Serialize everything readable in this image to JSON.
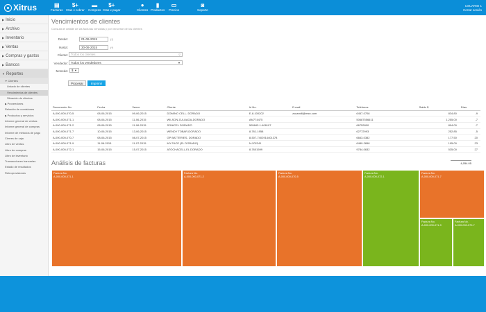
{
  "app": {
    "logo": "Xitrus"
  },
  "toolbar": [
    {
      "label": "Facturas",
      "icon": "invoice-icon",
      "glyph": "▤"
    },
    {
      "label": "Ctas x cobrar",
      "icon": "receivable-icon",
      "glyph": "$+"
    },
    {
      "label": "Compras",
      "icon": "folder-icon",
      "glyph": "▬"
    },
    {
      "label": "Ctas x pagar",
      "icon": "payable-icon",
      "glyph": "$+"
    },
    {
      "label": "Clientes",
      "icon": "user-icon",
      "glyph": "●"
    },
    {
      "label": "Productos",
      "icon": "box-icon",
      "glyph": "▮"
    },
    {
      "label": "Precios",
      "icon": "tag-icon",
      "glyph": "▭"
    },
    {
      "label": "Soporte",
      "icon": "chat-icon",
      "glyph": "◙"
    }
  ],
  "user": {
    "name": "USUARIO 1",
    "logout": "Cerrar sesión"
  },
  "sidebar": {
    "top_items": [
      "Inicio",
      "Archivo",
      "Inventario",
      "Ventas",
      "Compras y gastos",
      "Bancos"
    ],
    "reports": "Reportes",
    "clients": "Clientes",
    "client_items": [
      "Listado de clientes",
      "Vencimientos de clientes",
      "Situación de clientes"
    ],
    "other_items": [
      "Proveedores",
      "Relación de comisiones",
      "Productos y servicios",
      "Informe general de ventas",
      "Informe general de compras",
      "Informe de métodos de pago",
      "Cierres de caja",
      "Libro de ventas",
      "Libro de compras",
      "Libro de inventario",
      "Transacciones bancarias",
      "Estado de resultados",
      "Retroprovisiones"
    ]
  },
  "page": {
    "title": "Vencimientos de clientes",
    "subtitle": "Consulta el detalle de las facturas vencidas y por vencerse de los clientes"
  },
  "filters": {
    "desde_label": "Desde:",
    "desde_value": "01-06-2015",
    "hasta_label": "Hasta:",
    "hasta_value": "30-06-2015",
    "date_hint": "(*)",
    "cliente_label": "Cliente:",
    "cliente_placeholder": "Todos los clientes",
    "vendedor_label": "Vendedor:",
    "vendedor_value": "Todos los vendedores",
    "moneda_label": "Moneda:",
    "moneda_value": "$"
  },
  "actions": {
    "process": "Procesar",
    "print": "Imprimir"
  },
  "table": {
    "headers": [
      "Documento No.",
      "Fecha",
      "Vence",
      "Cliente",
      "Id No.",
      "E-mail",
      "Teléfonos",
      "Saldo $",
      "Días"
    ],
    "rows": [
      [
        "A-000-000-070-5",
        "08-06-2015",
        "09-06-2015",
        "DOMINO CELL- DORADO",
        "E-8-100202",
        "",
        "6457-0708",
        "834.80",
        "-9"
      ],
      [
        "A-000-000-071-1",
        "08-06-2015",
        "11-06-2015",
        "WILSON ZULUAGA-DORADO",
        "AM774475",
        "",
        "50687556611",
        "1,255.00",
        "-7"
      ],
      [
        "A-000-000-071-2",
        "08-06-2015",
        "11-06-2015",
        "SONICEL DORADO",
        "505843-1-406107",
        "",
        "66752800",
        "804.00",
        "-7"
      ],
      [
        "A-000-000-071-7",
        "10-06-2015",
        "13-06-2015",
        "WENDY TOBAR-DORADO",
        "8-761-1958",
        "",
        "62772993",
        "252.85",
        "-5"
      ],
      [
        "A-000-000-070-7",
        "08-06-2015",
        "08-07-2015",
        "GP BATTERIES- DORADO",
        "8-507-7402914401378",
        "",
        "6663-0382",
        "177.50",
        "20"
      ],
      [
        "A-000-000-071-9",
        "11-06-2015",
        "11-07-2015",
        "MY FACE (EL DORADO)",
        "N-202241",
        "",
        "6489-2658",
        "195.00",
        "23"
      ],
      [
        "A-000-000-072-1",
        "15-06-2015",
        "15-07-2015",
        "ATOCHACELL-EL DORADO",
        "8-7601599",
        "",
        "9784-0632",
        "535.00",
        "27"
      ]
    ],
    "email_shown": "zocami6@msn.com",
    "total": "4,054.05"
  },
  "analysis": {
    "title": "Análisis de facturas",
    "tiles": [
      {
        "label": "Factura No.",
        "doc": "A-000-000-071-1"
      },
      {
        "label": "Factura No.",
        "doc": "A-000-000-071-2"
      },
      {
        "label": "Factura No.",
        "doc": "A-000-000-070-5"
      },
      {
        "label": "Factura No.",
        "doc": "A-000-000-072-1"
      },
      {
        "label": "Factura No.",
        "doc": "A-000-000-071-7"
      },
      {
        "label": "Factura No.",
        "doc": "A-000-000-071-9"
      },
      {
        "label": "Factura No.",
        "doc": "A-000-000-070-7"
      }
    ]
  },
  "colors": {
    "brand": "#0b8ed8",
    "overdue": "#e8732a",
    "pending": "#7ab51d"
  }
}
